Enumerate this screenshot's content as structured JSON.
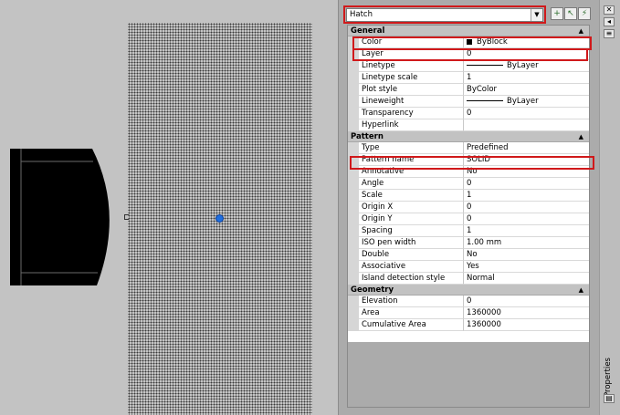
{
  "window": {
    "strip_title": "Properties"
  },
  "selector": {
    "value": "Hatch"
  },
  "toolbar": {
    "toggle_pickadd_icon": "plus-box-icon",
    "select_objects_icon": "cursor-select-icon",
    "quick_select_icon": "quick-select-icon"
  },
  "colors": {
    "highlight": "#d0191b",
    "grip": "#1f6fe0"
  },
  "categories": {
    "general": {
      "title": "General",
      "rows": [
        {
          "name": "Color",
          "value": "ByBlock"
        },
        {
          "name": "Layer",
          "value": "0"
        },
        {
          "name": "Linetype",
          "value": "ByLayer"
        },
        {
          "name": "Linetype scale",
          "value": "1"
        },
        {
          "name": "Plot style",
          "value": "ByColor"
        },
        {
          "name": "Lineweight",
          "value": "ByLayer"
        },
        {
          "name": "Transparency",
          "value": "0"
        },
        {
          "name": "Hyperlink",
          "value": ""
        }
      ]
    },
    "pattern": {
      "title": "Pattern",
      "rows": [
        {
          "name": "Type",
          "value": "Predefined"
        },
        {
          "name": "Pattern name",
          "value": "SOLID"
        },
        {
          "name": "Annotative",
          "value": "No"
        },
        {
          "name": "Angle",
          "value": "0"
        },
        {
          "name": "Scale",
          "value": "1"
        },
        {
          "name": "Origin X",
          "value": "0"
        },
        {
          "name": "Origin Y",
          "value": "0"
        },
        {
          "name": "Spacing",
          "value": "1"
        },
        {
          "name": "ISO pen width",
          "value": "1.00 mm"
        },
        {
          "name": "Double",
          "value": "No"
        },
        {
          "name": "Associative",
          "value": "Yes"
        },
        {
          "name": "Island detection style",
          "value": "Normal"
        }
      ]
    },
    "geometry": {
      "title": "Geometry",
      "rows": [
        {
          "name": "Elevation",
          "value": "0"
        },
        {
          "name": "Area",
          "value": "1360000"
        },
        {
          "name": "Cumulative Area",
          "value": "1360000"
        }
      ]
    }
  }
}
